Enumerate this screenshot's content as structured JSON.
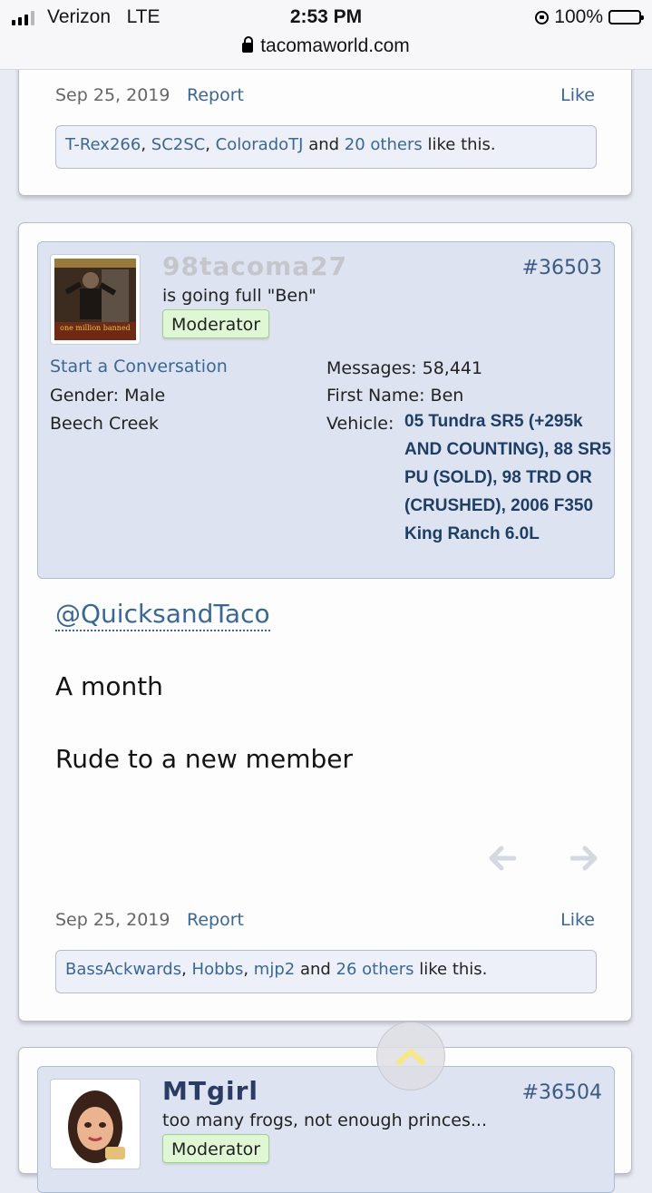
{
  "status_bar": {
    "carrier": "Verizon",
    "network": "LTE",
    "time": "2:53 PM",
    "battery": "100%",
    "url": "tacomaworld.com"
  },
  "post_prev": {
    "date": "Sep 25, 2019",
    "report_label": "Report",
    "like_label": "Like",
    "likes": {
      "users": [
        "T-Rex266",
        "SC2SC",
        "ColoradoTJ"
      ],
      "and_label": "and",
      "others": "20 others",
      "suffix": "like this."
    }
  },
  "post_main": {
    "username": "98tacoma27",
    "user_title": "is going full \"Ben\"",
    "badge": "Moderator",
    "post_number": "#36503",
    "avatar_caption": "one million banned",
    "start_conversation": "Start a Conversation",
    "gender_label": "Gender:",
    "gender_value": "Male",
    "location": "Beech Creek",
    "messages_label": "Messages:",
    "messages_value": "58,441",
    "first_name_label": "First Name:",
    "first_name_value": "Ben",
    "vehicle_label": "Vehicle:",
    "vehicle_value": "05 Tundra SR5 (+295k AND COUNTING), 88 SR5 PU (SOLD), 98 TRD OR (CRUSHED), 2006 F350 King Ranch 6.0L",
    "mention": "@QuicksandTaco",
    "message_lines": [
      "A month",
      "Rude to a new member"
    ],
    "date": "Sep 25, 2019",
    "report_label": "Report",
    "like_label": "Like",
    "likes": {
      "users": [
        "BassAckwards",
        "Hobbs",
        "mjp2"
      ],
      "and_label": "and",
      "others": "26 others",
      "suffix": "like this."
    }
  },
  "post_next": {
    "username": "MTgirl",
    "user_title": "too many frogs, not enough princes...",
    "badge": "Moderator",
    "post_number": "#36504"
  },
  "colors": {
    "link": "#3b6795",
    "userbox_bg": "#dde3f0",
    "badge_bg": "#dff7d4",
    "vehicle_text": "#1f3e66"
  }
}
